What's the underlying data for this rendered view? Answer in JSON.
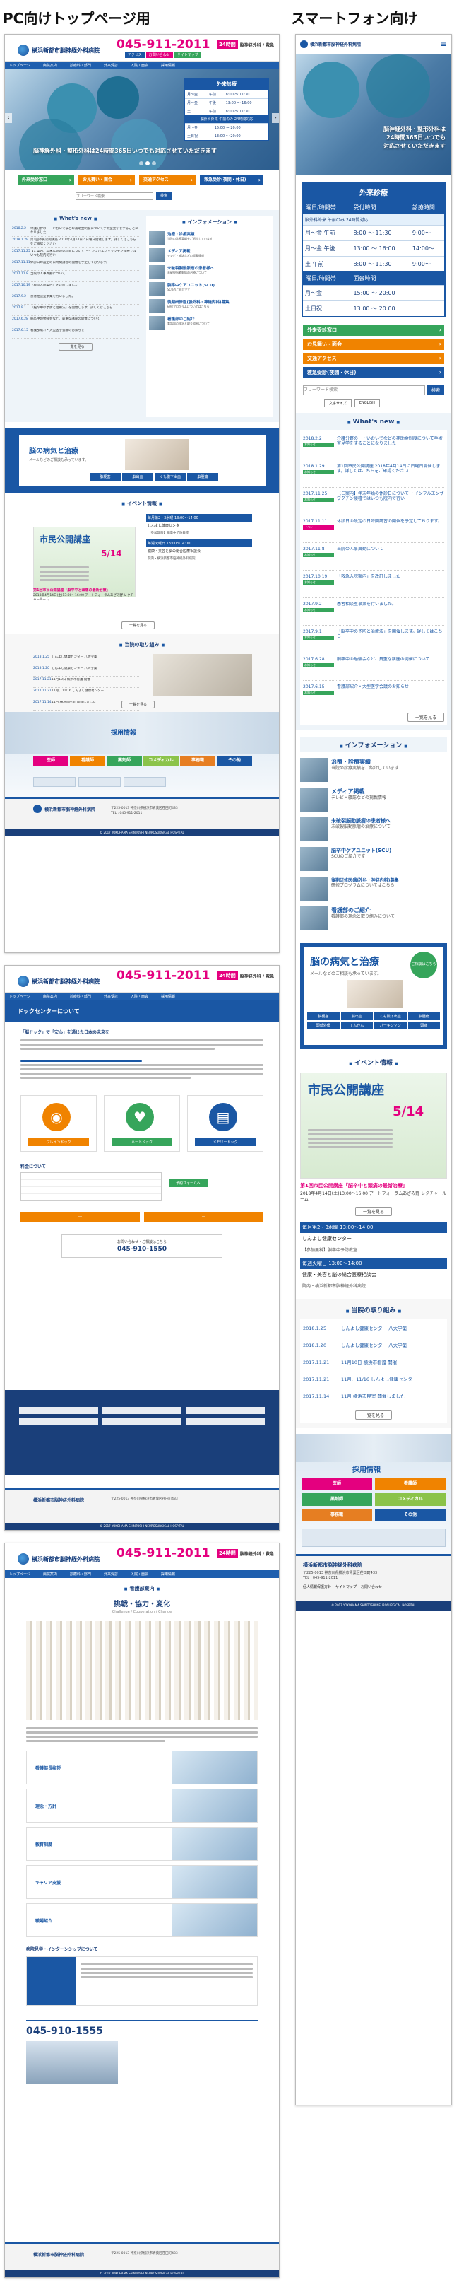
{
  "labels": {
    "pc": "PC向けトップページ用",
    "sp": "スマートフォン向け"
  },
  "header": {
    "hospital_name": "横浜新都市脳神経外科病院",
    "phone": "045-911-2011",
    "badge_24": "24時間",
    "phone_note": "脳神経外科 / 救急",
    "buttons": [
      "アクセス",
      "お問い合わせ",
      "サイトマップ"
    ]
  },
  "nav": [
    "トップページ",
    "病院案内",
    "診療科・部門",
    "外来受診",
    "入院・面会",
    "採用情報"
  ],
  "hero": {
    "caption_pc": "脳神経外科・整形外科は24時間365日いつでも対応させていただきます",
    "caption_sp": [
      "脳神経外科・整形外科は",
      "24時間365日いつでも",
      "対応させていただきます"
    ]
  },
  "hours": {
    "title": "外来診療",
    "head": [
      "曜日/時間帯",
      "受付時間",
      "診療時間"
    ],
    "emergency": "脳外科外来 午前のみ 24時間対応",
    "rows": [
      {
        "day": "月〜金",
        "slot": "午前",
        "reception": "8:00 〜 11:30",
        "clinic": "9:00〜"
      },
      {
        "day": "月〜金",
        "slot": "午後",
        "reception": "13:00 〜 16:00",
        "clinic": "14:00〜"
      },
      {
        "day": "土",
        "slot": "午前",
        "reception": "8:00 〜 11:30",
        "clinic": "9:00〜"
      }
    ],
    "head2": [
      "曜日/時間帯",
      "面会時間"
    ],
    "rows2": [
      {
        "day": "月〜金",
        "time": "15:00 〜 20:00"
      },
      {
        "day": "土日祝",
        "time": "13:00 〜 20:00"
      }
    ]
  },
  "quick": {
    "outpatient": "外来受診窓口",
    "visit": "お見舞い・面会",
    "access": "交通アクセス",
    "emergency": "救急受診(夜間・休日)"
  },
  "search": {
    "placeholder": "フリーワード検索",
    "button": "検索",
    "tags": [
      "文字サイズ",
      "ENGLISH"
    ]
  },
  "whatsnew": {
    "title": "What's new",
    "items": [
      {
        "date": "2018.2.2",
        "tag": "お知らせ",
        "text": "介護分野の一・いおいでなどの補助金制度について手術室見学をすることになりました"
      },
      {
        "date": "2018.1.29",
        "tag": "お知らせ",
        "text": "第1回市民公開講座 2018年4月14日に日曜日開催します。詳しくはこちらをご確認ください"
      },
      {
        "date": "2017.11.25",
        "tag": "お知らせ",
        "text": "【ご案内】年末年始の休診日について ・インフルエンザワクチン接種ではいつも院内で行い"
      },
      {
        "date": "2017.11.11",
        "tag": "イベント",
        "text": "休診日の設定の日時間講習の開催を予定しております。"
      },
      {
        "date": "2017.11.8",
        "tag": "お知らせ",
        "text": "当院の人事異動について"
      },
      {
        "date": "2017.10.19",
        "tag": "お知らせ",
        "text": "「救急入院案内」を改訂しました"
      },
      {
        "date": "2017.9.2",
        "tag": "お知らせ",
        "text": "患者相談室事業を行いました。"
      },
      {
        "date": "2017.9.1",
        "tag": "お知らせ",
        "text": "「脳卒中の予防と治療法」を開催します。詳しくはこちら"
      },
      {
        "date": "2017.6.28",
        "tag": "お知らせ",
        "text": "脳卒中の勉強会など、貴重な講座の開催について"
      },
      {
        "date": "2017.6.15",
        "tag": "お知らせ",
        "text": "看護部紹介・大型医学会議のお知らせ"
      }
    ],
    "more": "一覧を見る"
  },
  "information": {
    "title": "インフォメーション",
    "items": [
      {
        "title": "治療・診療実績",
        "desc": "当院の診療実績をご紹介しています"
      },
      {
        "title": "メディア掲載",
        "desc": "テレビ・雑誌などの掲載情報"
      },
      {
        "title": "未破裂脳動脈瘤の患者様へ",
        "desc": "未破裂脳動脈瘤の治療について"
      },
      {
        "title": "脳卒中ケアユニット(SCU)",
        "desc": "SCUのご紹介です"
      },
      {
        "title": "後期研修医(脳外科・神経内科)募集",
        "desc": "研修プログラムについてはこちら"
      },
      {
        "title": "看護部のご紹介",
        "desc": "看護部の理念と取り組みについて"
      }
    ]
  },
  "brain": {
    "title": "脳の病気と治療",
    "sub": "メールなどのご相談も承っています。",
    "badge": "ご相談はこちら",
    "grid": [
      "脳梗塞",
      "脳出血",
      "くも膜下出血",
      "脳腫瘍",
      "頭部外傷",
      "てんかん",
      "パーキンソン",
      "頭痛"
    ]
  },
  "event": {
    "title": "イベント情報",
    "poster": "市民公開講座",
    "poster_date": "5/14",
    "caption": "第1回市民公開講座「脳卒中と頭痛の最新治療」",
    "date_line": "2018年4月14日(土)13:00〜16:00 アートフォーラムあざみ野 レクチャールーム",
    "more": "一覧を見る",
    "schedule": [
      {
        "date": "毎月第2・3水曜 13:00〜14:00",
        "place": "しんよし健康センター",
        "note": "【参加無料】脳卒中予防教室"
      },
      {
        "date": "毎週火曜日 13:00〜14:00",
        "place": "健康・美容と脳の総合医療相談会",
        "note": "院内・横浜新都市脳神経外科病院"
      }
    ]
  },
  "efforts": {
    "title": "当院の取り組み",
    "items": [
      {
        "date": "2018.1.25",
        "text": "しんよし健康センター 八大学薬"
      },
      {
        "date": "2018.1.20",
        "text": "しんよし健康センター 八大学薬"
      },
      {
        "date": "2017.11.21",
        "text": "11月10日 横浜市看護 開催"
      },
      {
        "date": "2017.11.21",
        "text": "11月、11/16 しんよし健康センター"
      },
      {
        "date": "2017.11.14",
        "text": "11月 横浜市民室 開催しました"
      }
    ],
    "more": "一覧を見る"
  },
  "recruit": {
    "title": "採用情報",
    "items": [
      "医師",
      "看護師",
      "薬剤師",
      "コメディカル",
      "事務職",
      "その他"
    ]
  },
  "footer": {
    "name": "横浜新都市脳神経外科病院",
    "address": "〒225-0013 神奈川県横浜市青葉区荏田町433",
    "tel": "TEL : 045-911-2011",
    "copyright": "© 2017 YOKOHAMA SHINTOSHI NEUROSURGICAL HOSPITAL",
    "links": [
      "個人情報保護方針",
      "サイトマップ",
      "お問い合わせ"
    ]
  },
  "dock": {
    "title": "ドックセンターについて",
    "lead": "「脳ドック」で「安心」を通じた日本の未来を",
    "features": [
      "ブレインドック",
      "ハートドック",
      "メモリードック"
    ],
    "prices_title": "料金について",
    "booking_button": "予約フォームへ",
    "contact_tel": "045-910-1550",
    "contact_title": "お問い合わせ・ご相談はこちら"
  },
  "nursing": {
    "title": "看護部案内",
    "motto": "挑戦・協力・変化",
    "motto_en": "Challenge / Cooperation / Change",
    "sections": [
      "看護部長挨拶",
      "理念・方針",
      "教育制度",
      "キャリア支援",
      "職場紹介"
    ],
    "intern": "病院見学・インターンシップについて",
    "tel": "045-910-1555"
  }
}
